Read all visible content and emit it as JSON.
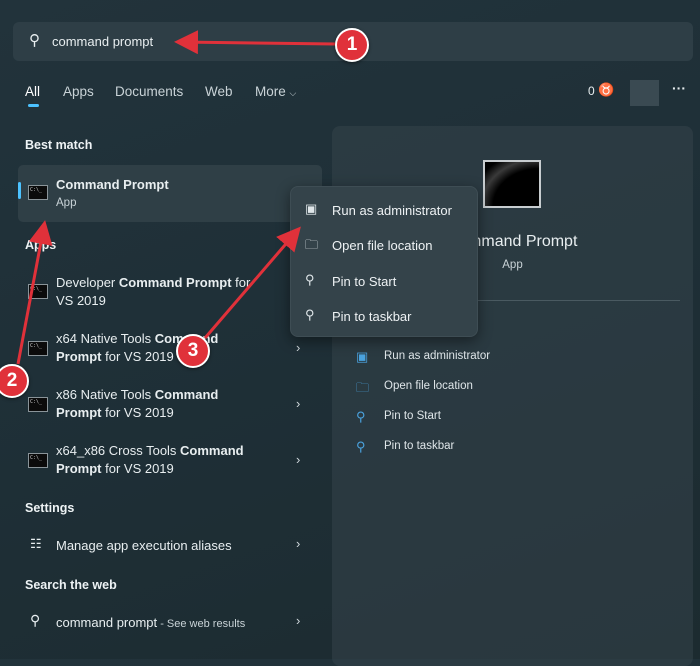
{
  "search": {
    "query": "command prompt"
  },
  "tabs": [
    {
      "label": "All"
    },
    {
      "label": "Apps"
    },
    {
      "label": "Documents"
    },
    {
      "label": "Web"
    },
    {
      "label": "More"
    }
  ],
  "header": {
    "points": "0"
  },
  "best_match": {
    "heading": "Best match",
    "title": "Command Prompt",
    "subtitle": "App"
  },
  "apps": {
    "heading": "Apps",
    "items": [
      {
        "pre": "Developer ",
        "bold": "Command Prompt",
        "post": " for",
        "line2_bold": "",
        "line2": "VS 2019"
      },
      {
        "pre": "x64 Native Tools ",
        "bold": "Command",
        "post": "",
        "line2_bold": "Prompt",
        "line2": " for VS 2019"
      },
      {
        "pre": "x86 Native Tools ",
        "bold": "Command",
        "post": "",
        "line2_bold": "Prompt",
        "line2": " for VS 2019"
      },
      {
        "pre": "x64_x86 Cross Tools ",
        "bold": "Command",
        "post": "",
        "line2_bold": "Prompt",
        "line2": " for VS 2019"
      }
    ]
  },
  "settings": {
    "heading": "Settings",
    "item": "Manage app execution aliases"
  },
  "web": {
    "heading": "Search the web",
    "query": "command prompt",
    "suffix": " - See web results"
  },
  "preview": {
    "title": "Command Prompt",
    "subtitle": "App",
    "actions": [
      "Run as administrator",
      "Open file location",
      "Pin to Start",
      "Pin to taskbar"
    ]
  },
  "context_menu": {
    "items": [
      "Run as administrator",
      "Open file location",
      "Pin to Start",
      "Pin to taskbar"
    ]
  },
  "annotations": [
    "1",
    "2",
    "3"
  ],
  "colors": {
    "accent": "#4cc2ff",
    "annotation": "#e0313a"
  }
}
